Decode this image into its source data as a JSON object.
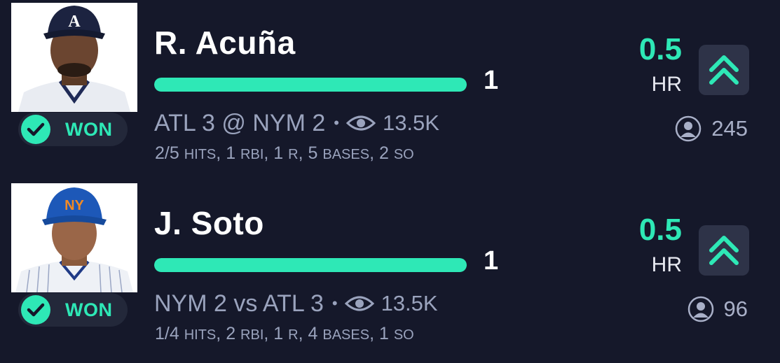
{
  "colors": {
    "background": "#15182a",
    "accent": "#2ee8b6",
    "muted_text": "#9aa3bd",
    "badge_bg": "#23283a",
    "button_bg": "#2e3348"
  },
  "props": [
    {
      "player_name": "R. Acuña",
      "avatar_icon": "player-headshot-braves",
      "result_label": "WON",
      "progress_fraction": 1.0,
      "progress_value": "1",
      "game": "ATL 3 @ NYM 2",
      "separator": "•",
      "views_icon": "eye-icon",
      "views": "13.5K",
      "stats": {
        "hits": "2/5",
        "hits_label": "HITS",
        "rbi": "1",
        "rbi_label": "RBI",
        "runs": "1",
        "runs_label": "R",
        "bases": "5",
        "bases_label": "BASES",
        "so": "2",
        "so_label": "SO"
      },
      "line": "0.5",
      "stat_type": "HR",
      "direction_icon": "double-chevron-up-icon",
      "picks_icon": "user-icon",
      "picks": "245"
    },
    {
      "player_name": "J. Soto",
      "avatar_icon": "player-headshot-mets",
      "result_label": "WON",
      "progress_fraction": 1.0,
      "progress_value": "1",
      "game": "NYM 2 vs ATL 3",
      "separator": "•",
      "views_icon": "eye-icon",
      "views": "13.5K",
      "stats": {
        "hits": "1/4",
        "hits_label": "HITS",
        "rbi": "2",
        "rbi_label": "RBI",
        "runs": "1",
        "runs_label": "R",
        "bases": "4",
        "bases_label": "BASES",
        "so": "1",
        "so_label": "SO"
      },
      "line": "0.5",
      "stat_type": "HR",
      "direction_icon": "double-chevron-up-icon",
      "picks_icon": "user-icon",
      "picks": "96"
    }
  ]
}
